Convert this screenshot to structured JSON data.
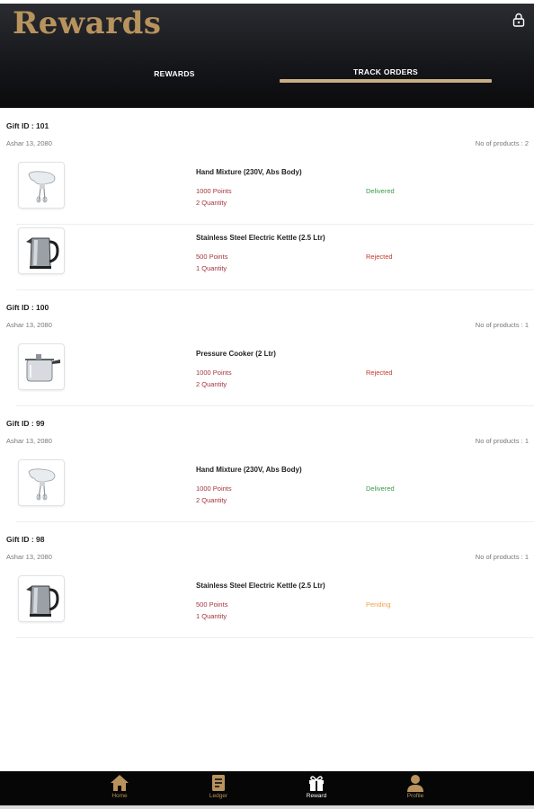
{
  "header": {
    "title": "Rewards",
    "tabs": [
      {
        "label": "REWARDS",
        "active": false
      },
      {
        "label": "TRACK ORDERS",
        "active": true
      }
    ]
  },
  "colors": {
    "brand_gold": "#b8935d",
    "header_bg": "#15161a",
    "tab_underline": "#c9ad85",
    "points_red": "#a3343e",
    "delivered_green": "#3a9a4d",
    "rejected_red": "#c0392b",
    "pending_orange": "#f0a04b"
  },
  "gifts": [
    {
      "id_label": "Gift ID : 101",
      "date": "Ashar 13, 2080",
      "count_label": "No of products : 2",
      "items": [
        {
          "name": "Hand Mixture (230V, Abs Body)",
          "points": "1000 Points",
          "quantity": "2 Quantity",
          "status": "Delivered",
          "icon": "hand-mixer-icon"
        },
        {
          "name": "Stainless Steel Electric Kettle (2.5 Ltr)",
          "points": "500 Points",
          "quantity": "1 Quantity",
          "status": "Rejected",
          "icon": "kettle-icon"
        }
      ]
    },
    {
      "id_label": "Gift ID : 100",
      "date": "Ashar 13, 2080",
      "count_label": "No of products : 1",
      "items": [
        {
          "name": "Pressure Cooker (2 Ltr)",
          "points": "1000 Points",
          "quantity": "2 Quantity",
          "status": "Rejected",
          "icon": "pressure-cooker-icon"
        }
      ]
    },
    {
      "id_label": "Gift ID : 99",
      "date": "Ashar 13, 2080",
      "count_label": "No of products : 1",
      "items": [
        {
          "name": "Hand Mixture (230V, Abs Body)",
          "points": "1000 Points",
          "quantity": "2 Quantity",
          "status": "Delivered",
          "icon": "hand-mixer-icon"
        }
      ]
    },
    {
      "id_label": "Gift ID : 98",
      "date": "Ashar 13, 2080",
      "count_label": "No of products : 1",
      "items": [
        {
          "name": "Stainless Steel Electric Kettle (2.5 Ltr)",
          "points": "500 Points",
          "quantity": "1 Quantity",
          "status": "Pending",
          "icon": "kettle-icon"
        }
      ]
    }
  ],
  "bottom_nav": [
    {
      "label": "Home",
      "icon": "home-icon",
      "active": false
    },
    {
      "label": "Ledger",
      "icon": "ledger-icon",
      "active": false
    },
    {
      "label": "Reward",
      "icon": "gift-icon",
      "active": true
    },
    {
      "label": "Profile",
      "icon": "profile-icon",
      "active": false
    }
  ]
}
